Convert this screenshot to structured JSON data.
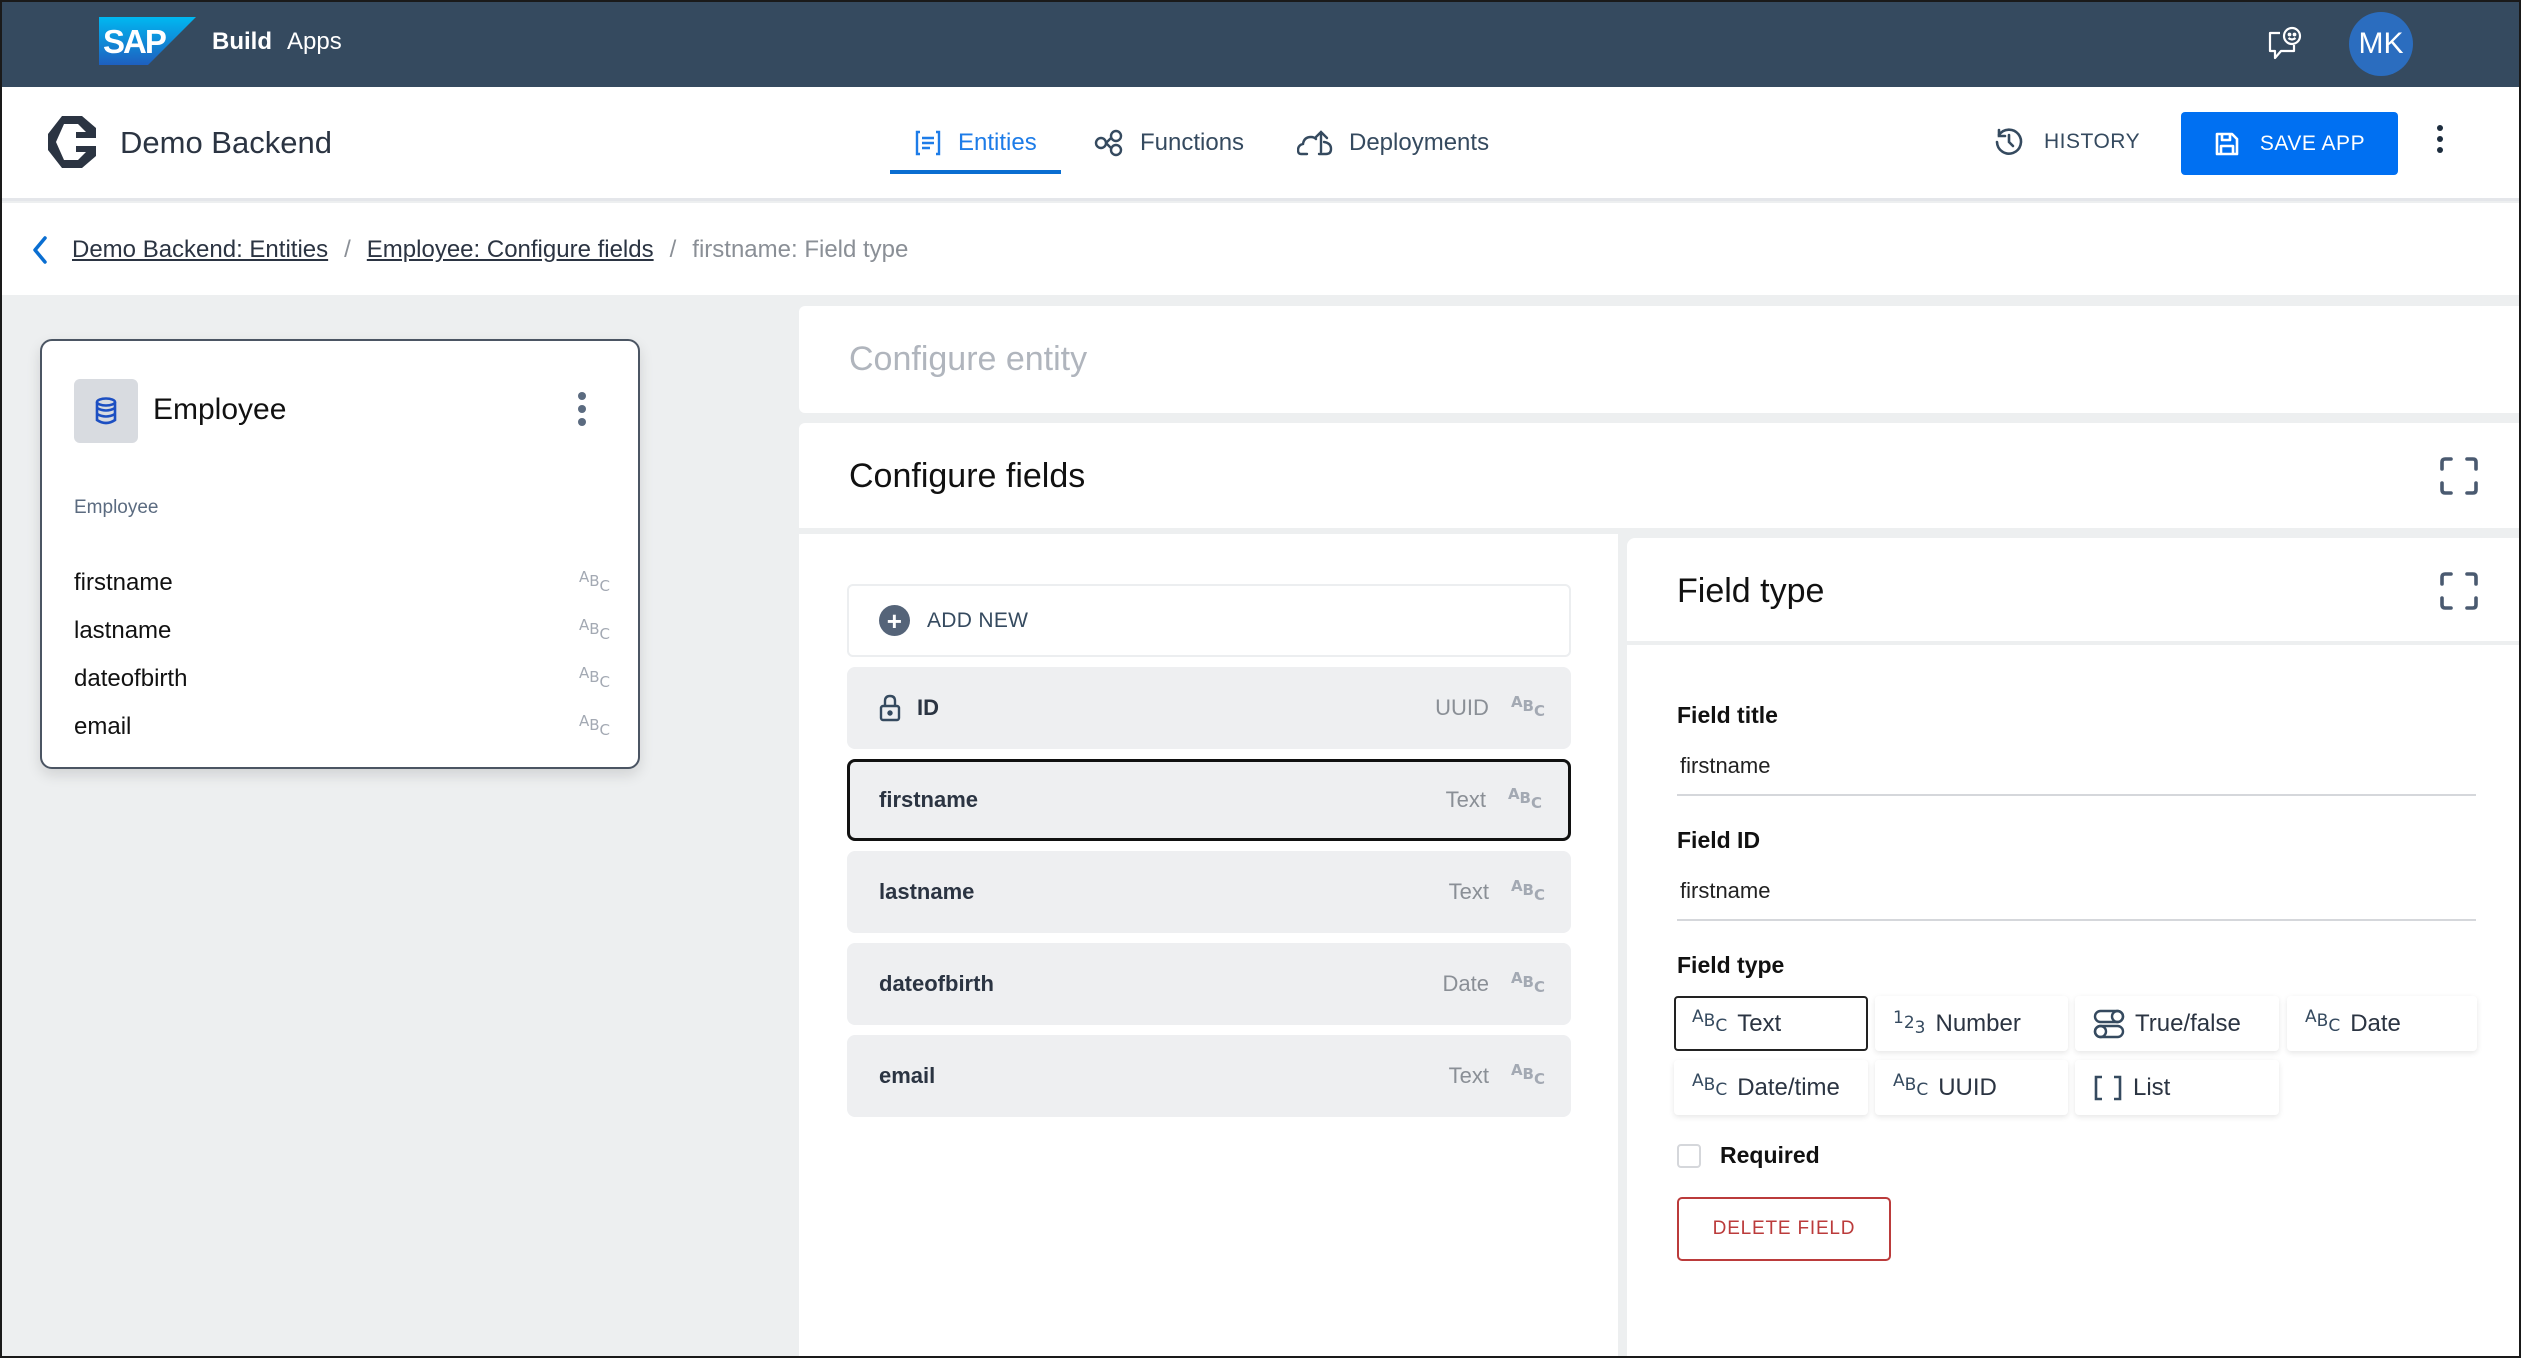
{
  "shell": {
    "brand_logo": "SAP",
    "product_bold": "Build",
    "product": "Apps",
    "feedback_icon": "feedback-chat-smiley-icon",
    "avatar_initials": "MK"
  },
  "app_header": {
    "app_name": "Demo Backend",
    "tabs": [
      {
        "label": "Entities",
        "icon": "entities-list-icon",
        "active": true
      },
      {
        "label": "Functions",
        "icon": "functions-nodes-icon",
        "active": false
      },
      {
        "label": "Deployments",
        "icon": "cloud-upload-icon",
        "active": false
      }
    ],
    "history_label": "HISTORY",
    "save_label": "SAVE APP",
    "colors": {
      "shell": "#354a5f",
      "accent": "#0070f2"
    }
  },
  "breadcrumb": {
    "items": [
      {
        "label": "Demo Backend: Entities",
        "link": true
      },
      {
        "label": "Employee: Configure fields",
        "link": true
      },
      {
        "label": "firstname: Field type",
        "link": false
      }
    ],
    "separator": "/"
  },
  "entity_card": {
    "title": "Employee",
    "subtitle": "Employee",
    "fields": [
      {
        "name": "firstname",
        "type_icon": "ABC"
      },
      {
        "name": "lastname",
        "type_icon": "ABC"
      },
      {
        "name": "dateofbirth",
        "type_icon": "ABC"
      },
      {
        "name": "email",
        "type_icon": "ABC"
      }
    ]
  },
  "configure_entity": {
    "title": "Configure entity"
  },
  "configure_fields": {
    "title": "Configure fields",
    "add_new_label": "ADD NEW",
    "fields": [
      {
        "name": "ID",
        "type": "UUID",
        "locked": true,
        "selected": false
      },
      {
        "name": "firstname",
        "type": "Text",
        "locked": false,
        "selected": true
      },
      {
        "name": "lastname",
        "type": "Text",
        "locked": false,
        "selected": false
      },
      {
        "name": "dateofbirth",
        "type": "Date",
        "locked": false,
        "selected": false
      },
      {
        "name": "email",
        "type": "Text",
        "locked": false,
        "selected": false
      }
    ]
  },
  "field_type_panel": {
    "title": "Field type",
    "field_title_label": "Field title",
    "field_title_value": "firstname",
    "field_id_label": "Field ID",
    "field_id_value": "firstname",
    "field_type_label": "Field type",
    "type_options": [
      {
        "label": "Text",
        "icon": "abc-icon",
        "selected": true
      },
      {
        "label": "Number",
        "icon": "123-icon",
        "selected": false
      },
      {
        "label": "True/false",
        "icon": "toggle-icon",
        "selected": false
      },
      {
        "label": "Date",
        "icon": "abc-icon",
        "selected": false
      },
      {
        "label": "Date/time",
        "icon": "abc-icon",
        "selected": false
      },
      {
        "label": "UUID",
        "icon": "abc-icon",
        "selected": false
      },
      {
        "label": "List",
        "icon": "brackets-icon",
        "selected": false
      }
    ],
    "required_label": "Required",
    "required_checked": false,
    "delete_label": "DELETE FIELD",
    "delete_color": "#bb3b3b"
  }
}
